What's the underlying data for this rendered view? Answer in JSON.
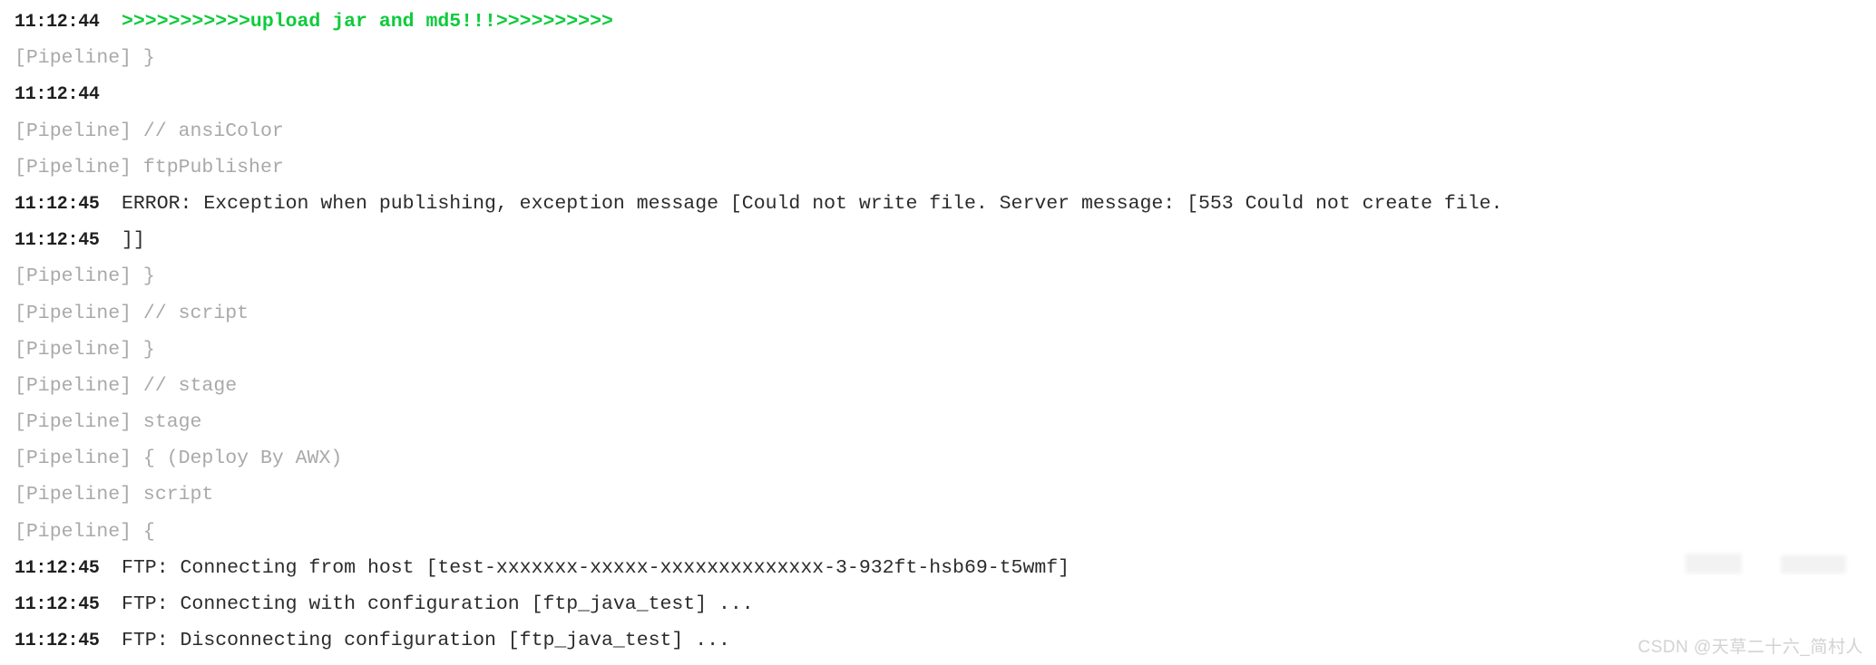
{
  "console": {
    "lines": [
      {
        "kind": "timestamped",
        "timestamp": "11:12:44",
        "message": ">>>>>>>>>>>upload jar and md5!!!>>>>>>>>>>",
        "style": "green"
      },
      {
        "kind": "pipeline",
        "timestamp": "",
        "message": "[Pipeline] }",
        "style": "muted"
      },
      {
        "kind": "timestamped",
        "timestamp": "11:12:44",
        "message": "",
        "style": "plain"
      },
      {
        "kind": "pipeline",
        "timestamp": "",
        "message": "[Pipeline] // ansiColor",
        "style": "muted"
      },
      {
        "kind": "pipeline",
        "timestamp": "",
        "message": "[Pipeline] ftpPublisher",
        "style": "muted"
      },
      {
        "kind": "timestamped",
        "timestamp": "11:12:45",
        "message": "ERROR: Exception when publishing, exception message [Could not write file. Server message: [553 Could not create file.",
        "style": "plain"
      },
      {
        "kind": "timestamped",
        "timestamp": "11:12:45",
        "message": "]]",
        "style": "plain"
      },
      {
        "kind": "pipeline",
        "timestamp": "",
        "message": "[Pipeline] }",
        "style": "muted"
      },
      {
        "kind": "pipeline",
        "timestamp": "",
        "message": "[Pipeline] // script",
        "style": "muted"
      },
      {
        "kind": "pipeline",
        "timestamp": "",
        "message": "[Pipeline] }",
        "style": "muted"
      },
      {
        "kind": "pipeline",
        "timestamp": "",
        "message": "[Pipeline] // stage",
        "style": "muted"
      },
      {
        "kind": "pipeline",
        "timestamp": "",
        "message": "[Pipeline] stage",
        "style": "muted"
      },
      {
        "kind": "pipeline",
        "timestamp": "",
        "message": "[Pipeline] { (Deploy By AWX)",
        "style": "muted"
      },
      {
        "kind": "pipeline",
        "timestamp": "",
        "message": "[Pipeline] script",
        "style": "muted"
      },
      {
        "kind": "pipeline",
        "timestamp": "",
        "message": "[Pipeline] {",
        "style": "muted"
      },
      {
        "kind": "timestamped",
        "timestamp": "11:12:45",
        "message": "FTP: Connecting from host [test-xxxxxxx-xxxxx-xxxxxxxxxxxxxx-3-932ft-hsb69-t5wmf]",
        "style": "plain",
        "redacted": true
      },
      {
        "kind": "timestamped",
        "timestamp": "11:12:45",
        "message": "FTP: Connecting with configuration [ftp_java_test] ...",
        "style": "plain"
      },
      {
        "kind": "timestamped",
        "timestamp": "11:12:45",
        "message": "FTP: Disconnecting configuration [ftp_java_test] ...",
        "style": "plain"
      }
    ]
  },
  "watermark": {
    "text": "CSDN @天草二十六_简村人"
  },
  "colors": {
    "background": "#ffffff",
    "timestamp": "#1f1f1f",
    "message": "#2b2b2b",
    "muted": "#a9a9a9",
    "green": "#0ecb3c",
    "watermark": "#d2d2d2"
  }
}
